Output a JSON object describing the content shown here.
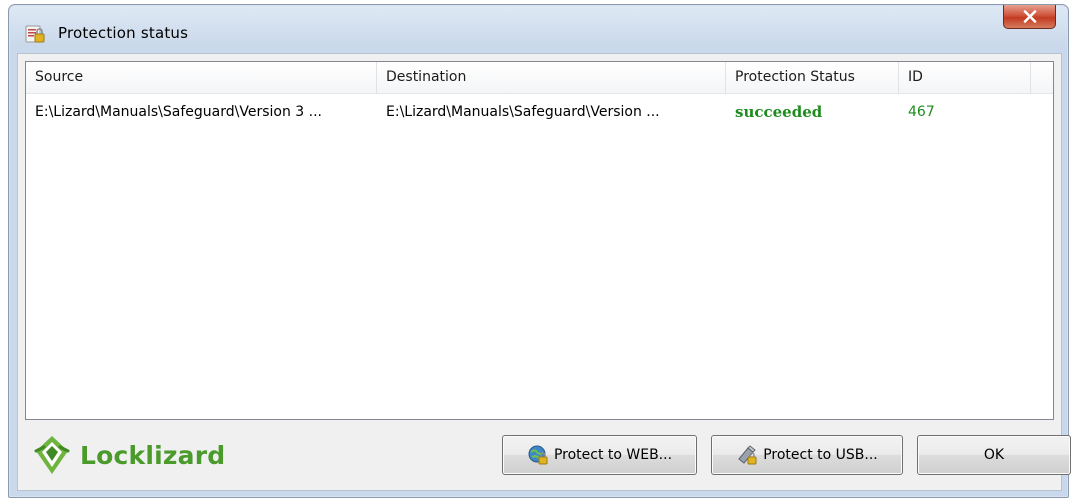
{
  "window": {
    "title": "Protection status",
    "close_label": "X"
  },
  "table": {
    "columns": [
      "Source",
      "Destination",
      "Protection Status",
      "ID"
    ],
    "rows": [
      {
        "source": "E:\\Lizard\\Manuals\\Safeguard\\Version 3 ...",
        "destination": "E:\\Lizard\\Manuals\\Safeguard\\Version ...",
        "status": "succeeded",
        "id": "467"
      }
    ]
  },
  "footer": {
    "logo_text": "Locklizard",
    "buttons": {
      "web": "Protect to WEB...",
      "usb": "Protect to USB...",
      "ok": "OK"
    }
  },
  "colors": {
    "success": "#1d8c1d",
    "brand": "#4a9a2c",
    "close": "#c33b22"
  },
  "icons": {
    "title": "shield-lock-icon",
    "web": "globe-lock-icon",
    "usb": "usb-lock-icon",
    "logo": "lizard-logo-icon"
  }
}
